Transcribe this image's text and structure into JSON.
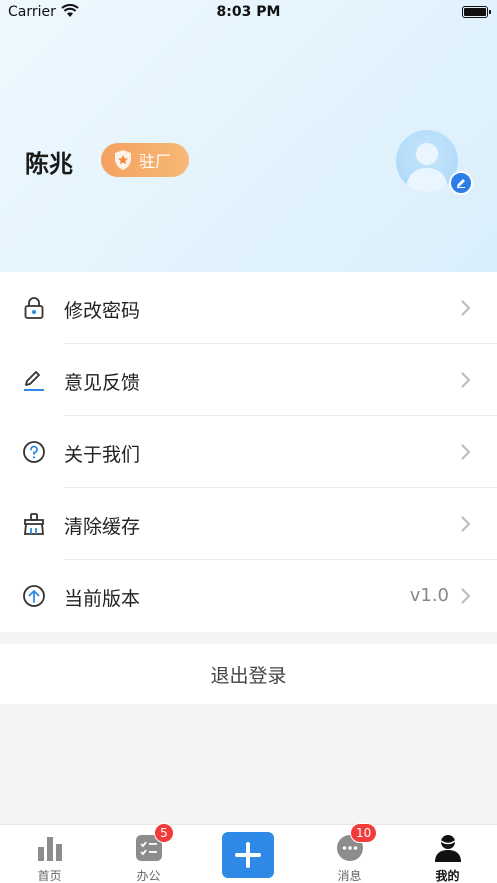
{
  "status_bar": {
    "carrier": "Carrier",
    "time": "8:03 PM"
  },
  "profile": {
    "name": "陈兆",
    "role": "驻厂",
    "avatar_icon": "user-avatar-icon",
    "edit_icon": "pencil-icon"
  },
  "menu": {
    "items": [
      {
        "label": "修改密码",
        "icon": "lock-icon",
        "value": ""
      },
      {
        "label": "意见反馈",
        "icon": "pencil-underline-icon",
        "value": ""
      },
      {
        "label": "关于我们",
        "icon": "question-circle-icon",
        "value": ""
      },
      {
        "label": "清除缓存",
        "icon": "broom-icon",
        "value": ""
      },
      {
        "label": "当前版本",
        "icon": "arrow-up-circle-icon",
        "value": "v1.0"
      }
    ]
  },
  "logout": {
    "label": "退出登录"
  },
  "tabbar": {
    "tabs": [
      {
        "label": "首页",
        "icon": "bar-chart-icon",
        "badge": ""
      },
      {
        "label": "办公",
        "icon": "checklist-icon",
        "badge": "5"
      },
      {
        "label": "",
        "icon": "plus-icon",
        "badge": ""
      },
      {
        "label": "消息",
        "icon": "chat-bubble-icon",
        "badge": "10"
      },
      {
        "label": "我的",
        "icon": "person-icon",
        "badge": ""
      }
    ]
  },
  "colors": {
    "accent": "#2e8ae6",
    "badge": "#f23b3b",
    "role_badge": "#f4a15f"
  }
}
